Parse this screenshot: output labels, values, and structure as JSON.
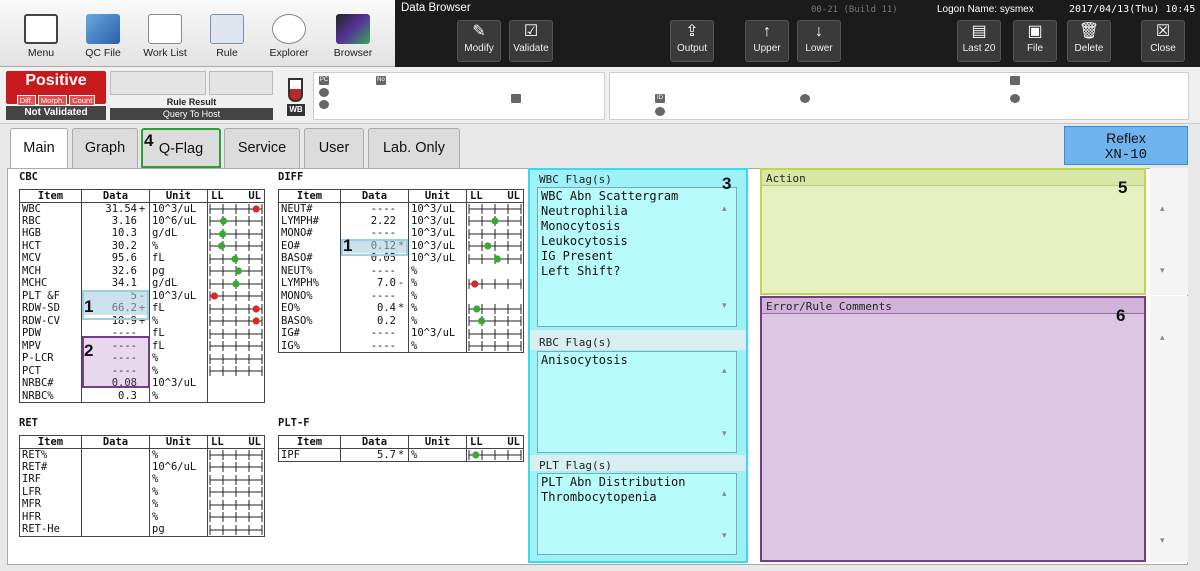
{
  "toolbar": {
    "left": [
      "Menu",
      "QC File",
      "Work List",
      "Rule",
      "Explorer",
      "Browser"
    ],
    "title": "Data Browser",
    "build": "00-21 (Build 11)",
    "logon": "Logon Name: sysmex",
    "datetime": "2017/04/13(Thu) 10:45",
    "right": [
      "Modify",
      "Validate",
      "Output",
      "Upper",
      "Lower",
      "Last 20",
      "File",
      "Delete",
      "Close"
    ]
  },
  "status": {
    "result": "Positive",
    "chips": [
      "Diff.",
      "Morph.",
      "Count"
    ],
    "validation": "Not Validated",
    "rule_result": "Rule Result",
    "query": "Query To Host",
    "sample_type": "WB"
  },
  "tabs": [
    "Main",
    "Graph",
    "Q-Flag",
    "Service",
    "User",
    "Lab. Only"
  ],
  "reflex": {
    "label": "Reflex",
    "model": "XN-10"
  },
  "headers": {
    "item": "Item",
    "data": "Data",
    "unit": "Unit",
    "ll": "LL",
    "ul": "UL"
  },
  "cbc": {
    "title": "CBC",
    "rows": [
      [
        "WBC",
        "31.54",
        "+",
        "10^3/uL",
        0.92
      ],
      [
        "RBC",
        "3.16",
        "",
        "10^6/uL",
        0.24
      ],
      [
        "HGB",
        "10.3",
        "",
        "g/dL",
        0.22
      ],
      [
        "HCT",
        "30.2",
        "",
        "%",
        0.2
      ],
      [
        "MCV",
        "95.6",
        "",
        "fL",
        0.48
      ],
      [
        "MCH",
        "32.6",
        "",
        "pg",
        0.55
      ],
      [
        "MCHC",
        "34.1",
        "",
        "g/dL",
        0.5
      ],
      [
        "PLT &F",
        "5",
        "-",
        "10^3/uL",
        0.05
      ],
      [
        "RDW-SD",
        "66.2",
        "+",
        "fL",
        0.92
      ],
      [
        "RDW-CV",
        "18.9",
        "+",
        "%",
        0.92
      ],
      [
        "PDW",
        "----",
        "",
        "fL",
        null
      ],
      [
        "MPV",
        "----",
        "",
        "fL",
        null
      ],
      [
        "P-LCR",
        "----",
        "",
        "%",
        null
      ],
      [
        "PCT",
        "----",
        "",
        "%",
        null
      ],
      [
        "NRBC#",
        "0.08",
        "",
        "10^3/uL",
        -1
      ],
      [
        "NRBC%",
        "0.3",
        "",
        "%",
        -1
      ]
    ]
  },
  "diff": {
    "title": "DIFF",
    "rows": [
      [
        "NEUT#",
        "----",
        "",
        "10^3/uL",
        null
      ],
      [
        "LYMPH#",
        "2.22",
        "",
        "10^3/uL",
        0.5
      ],
      [
        "MONO#",
        "----",
        "",
        "10^3/uL",
        null
      ],
      [
        "EO#",
        "0.12",
        "*",
        "10^3/uL",
        0.35
      ],
      [
        "BASO#",
        "0.05",
        "",
        "10^3/uL",
        0.55
      ],
      [
        "NEUT%",
        "----",
        "",
        "%",
        -1
      ],
      [
        "LYMPH%",
        "7.0",
        "-",
        "%",
        0.08
      ],
      [
        "MONO%",
        "----",
        "",
        "%",
        -1
      ],
      [
        "EO%",
        "0.4",
        "*",
        "%",
        0.12
      ],
      [
        "BASO%",
        "0.2",
        "",
        "%",
        0.22
      ],
      [
        "IG#",
        "----",
        "",
        "10^3/uL",
        null
      ],
      [
        "IG%",
        "----",
        "",
        "%",
        null
      ]
    ]
  },
  "ret": {
    "title": "RET",
    "rows": [
      [
        "RET%",
        "",
        "",
        "%",
        null
      ],
      [
        "RET#",
        "",
        "",
        "10^6/uL",
        null
      ],
      [
        "IRF",
        "",
        "",
        "%",
        null
      ],
      [
        "LFR",
        "",
        "",
        "%",
        null
      ],
      [
        "MFR",
        "",
        "",
        "%",
        null
      ],
      [
        "HFR",
        "",
        "",
        "%",
        null
      ],
      [
        "RET-He",
        "",
        "",
        "pg",
        null
      ]
    ]
  },
  "pltf": {
    "title": "PLT-F",
    "rows": [
      [
        "IPF",
        "5.7",
        "*",
        "%",
        0.1
      ]
    ]
  },
  "flags": {
    "wbc_title": "WBC Flag(s)",
    "wbc": [
      "WBC Abn Scattergram",
      "Neutrophilia",
      "Monocytosis",
      "Leukocytosis",
      "IG Present",
      "Left Shift?"
    ],
    "rbc_title": "RBC Flag(s)",
    "rbc": [
      "Anisocytosis"
    ],
    "plt_title": "PLT Flag(s)",
    "plt": [
      "PLT Abn Distribution",
      "Thrombocytopenia"
    ]
  },
  "action_title": "Action",
  "comments_title": "Error/Rule Comments",
  "callouts": [
    "1",
    "2",
    "3",
    "4",
    "5",
    "6"
  ],
  "colors": {
    "red": "#d42a2a",
    "green": "#3aa832",
    "cyan": "#3fd8e8",
    "lime": "#c2d64a",
    "purple": "#7a3a8c"
  }
}
